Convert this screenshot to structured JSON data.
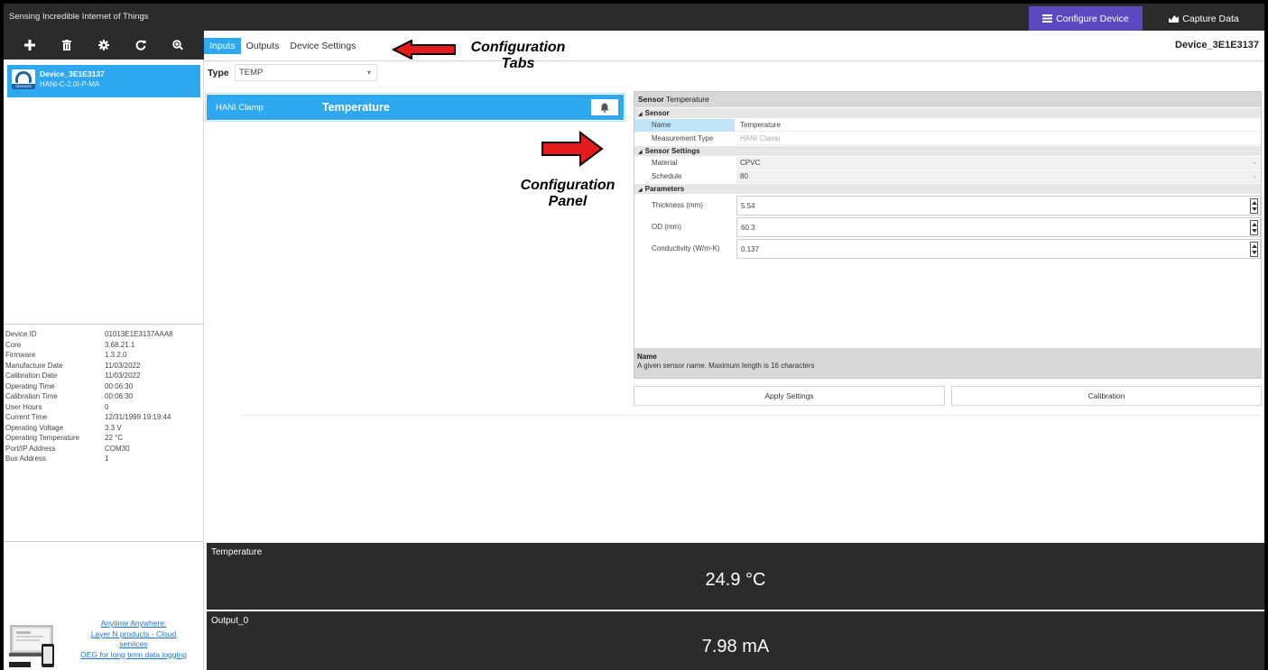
{
  "window": {
    "title": "Sensing Incredible Internet of Things"
  },
  "top_buttons": {
    "configure": "Configure Device",
    "capture": "Capture Data"
  },
  "toolbar": [
    "add-icon",
    "delete-icon",
    "gear-icon",
    "refresh-icon",
    "zoom-icon"
  ],
  "device_list": [
    {
      "name": "Device_3E1E3137",
      "model": "HANI-C-2.0I-P-MA",
      "logo_text": "SENSING"
    }
  ],
  "device_info": [
    {
      "key": "Device ID",
      "value": "01013E1E3137AAA8"
    },
    {
      "key": "Core",
      "value": "3.68.21.1"
    },
    {
      "key": "Firmware",
      "value": "1.3.2.0"
    },
    {
      "key": "Manufacture Date",
      "value": "11/03/2022"
    },
    {
      "key": "Calibration Date",
      "value": "11/03/2022"
    },
    {
      "key": "Operating Time",
      "value": "00:06:30"
    },
    {
      "key": "Calibration Time",
      "value": "00:06:30"
    },
    {
      "key": "User Hours",
      "value": "0"
    },
    {
      "key": "Current Time",
      "value": "12/31/1999 19:19:44"
    },
    {
      "key": "Operating Voltage",
      "value": "3.3 V"
    },
    {
      "key": "Operating Temperature",
      "value": "22 °C"
    },
    {
      "key": "Port/IP Address",
      "value": "COM30"
    },
    {
      "key": "Bus Address",
      "value": "1"
    }
  ],
  "promo": {
    "line1": "Anytime Anywhere:",
    "line2": "Layer N products - Cloud",
    "line3": "services",
    "line4": "OEG for long term data logging"
  },
  "tabs": [
    "Inputs",
    "Outputs",
    "Device Settings"
  ],
  "active_tab": "Inputs",
  "device_title": "Device_3E1E3137",
  "type": {
    "label": "Type",
    "value": "TEMP"
  },
  "sensor_card": {
    "kind": "HANI Clamp",
    "name": "Temperature"
  },
  "panel": {
    "header_bold": "Sensor",
    "header_text": "Temperature",
    "categories": {
      "sensor": "Sensor",
      "settings": "Sensor Settings",
      "params": "Parameters"
    },
    "fields": {
      "name": {
        "label": "Name",
        "value": "Temperature"
      },
      "mtype": {
        "label": "Measurement Type",
        "value": "HANI Clamp"
      },
      "material": {
        "label": "Material",
        "value": "CPVC"
      },
      "schedule": {
        "label": "Schedule",
        "value": "80"
      },
      "thickness": {
        "label": "Thickness (mm)",
        "value": "5.54"
      },
      "od": {
        "label": "OD (mm)",
        "value": "60.3"
      },
      "conductivity": {
        "label": "Conductivity (W/m-K)",
        "value": "0.137"
      }
    },
    "footer_title": "Name",
    "footer_text": "A given sensor name. Maximum length is 16 characters"
  },
  "buttons": {
    "apply": "Apply Settings",
    "calibration": "Calibration"
  },
  "readouts": [
    {
      "label": "Temperature",
      "value": "24.9 °C"
    },
    {
      "label": "Output_0",
      "value": "7.98 mA"
    }
  ],
  "annotations": {
    "tabs_line1": "Configuration",
    "tabs_line2": "Tabs",
    "panel_line1": "Configuration",
    "panel_line2": "Panel"
  },
  "colors": {
    "accent_blue": "#2ea8f0",
    "configure_purple": "#5b49c2",
    "dark_bar": "#2b2b2b",
    "arrow_red": "#e31b1b"
  }
}
